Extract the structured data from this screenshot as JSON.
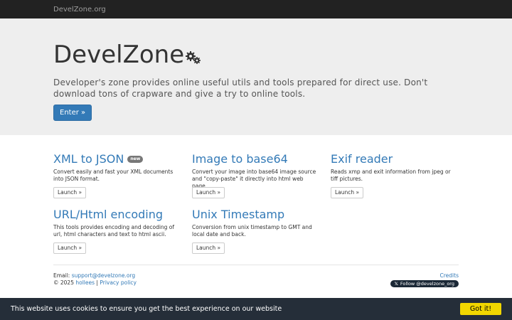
{
  "navbar": {
    "brand": "DevelZone.org"
  },
  "hero": {
    "title": "DevelZone",
    "description": "Developer's zone provides online useful utils and tools prepared for direct use. Don't download tons of crapware and give a try to online tools.",
    "enter_label": "Enter »"
  },
  "tools": [
    {
      "title": "XML to JSON",
      "badge": "new",
      "description": "Convert easily and fast your XML documents into JSON format.",
      "launch_label": "Launch »"
    },
    {
      "title": "Image to base64",
      "description": "Convert your image into base64 image source and \"copy-paste\" it directly into html web page.",
      "launch_label": "Launch »"
    },
    {
      "title": "Exif reader",
      "description": "Reads xmp and exit information from jpeg or tiff pictures.",
      "launch_label": "Launch »"
    },
    {
      "title": "URL/Html encoding",
      "description": "This tools provides encoding and decoding of url, html characters and text to html ascii.",
      "launch_label": "Launch »"
    },
    {
      "title": "Unix Timestamp",
      "description": "Conversion from unix timestamp to GMT and local date and back.",
      "launch_label": "Launch »"
    }
  ],
  "footer": {
    "email_label": "Email:",
    "email": "support@develzone.org",
    "copyright": "© 2025",
    "author": "hollees",
    "separator": "|",
    "privacy": "Privacy policy",
    "credits": "Credits",
    "twitter_follow": "Follow @develzone_org",
    "twitter_icon": "x-logo-icon"
  },
  "cookie": {
    "text": "This website uses cookies to ensure you get the best experience on our website",
    "button": "Got it!"
  },
  "colors": {
    "navbar_bg": "#222222",
    "hero_bg": "#eeeeee",
    "link": "#337ab7",
    "primary_button": "#337ab7",
    "cookie_bg": "#252e39",
    "cookie_button": "#f1d600"
  }
}
